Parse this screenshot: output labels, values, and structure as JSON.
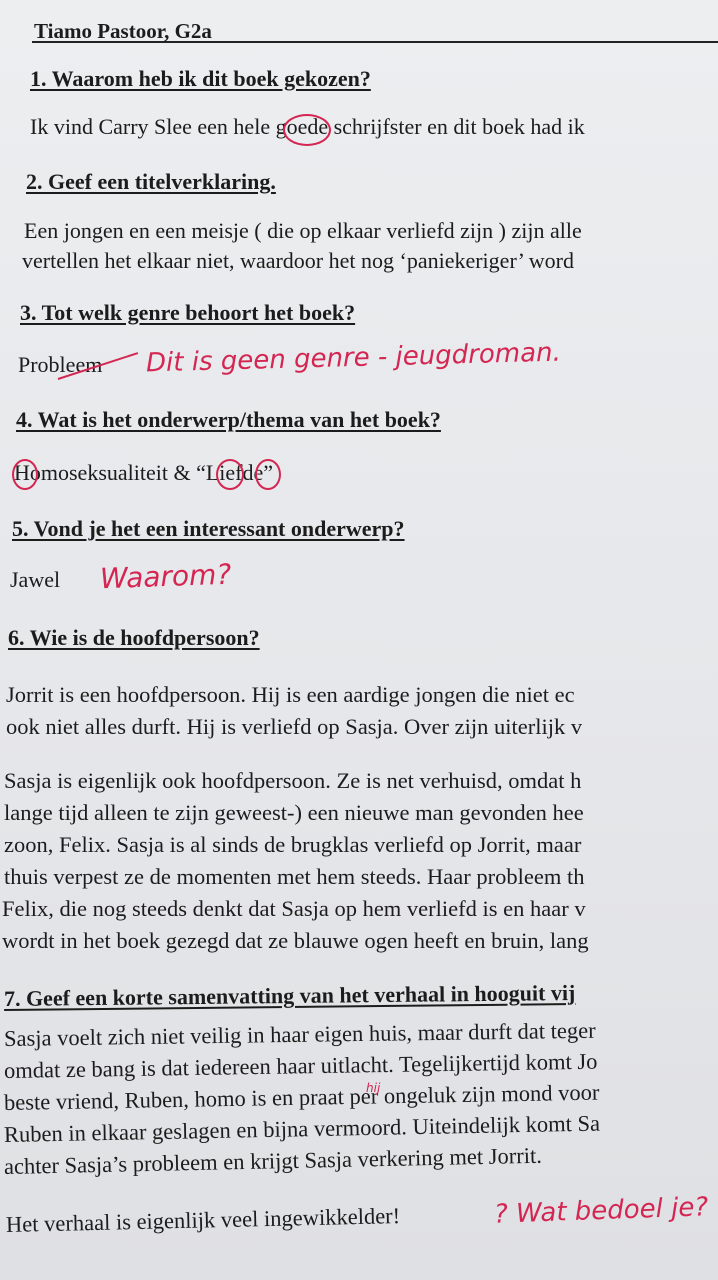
{
  "header": {
    "name": "Tiamo Pastoor, G2a"
  },
  "sections": [
    {
      "heading": "1. Waarom heb ik dit boek gekozen?",
      "lines": [
        "Ik vind Carry Slee een hele goede schrijfster en dit boek had ik"
      ]
    },
    {
      "heading": "2. Geef een titelverklaring.",
      "lines": [
        "Een jongen en een meisje ( die op elkaar verliefd zijn ) zijn alle",
        "vertellen het elkaar niet, waardoor het nog ‘paniekeriger’ word"
      ]
    },
    {
      "heading": "3. Tot welk genre behoort het boek?",
      "lines": [
        "Probleem"
      ]
    },
    {
      "heading": "4. Wat is het onderwerp/thema van het boek?",
      "lines": [
        "Homoseksualiteit & “Liefde”"
      ]
    },
    {
      "heading": "5. Vond je het een interessant onderwerp?",
      "lines": [
        "Jawel"
      ]
    },
    {
      "heading": "6. Wie is de hoofdpersoon?",
      "lines": [
        "Jorrit is een hoofdpersoon. Hij is een aardige jongen die niet ec",
        "ook niet alles durft. Hij is verliefd op Sasja. Over zijn uiterlijk v",
        "Sasja is eigenlijk ook hoofdpersoon. Ze is net verhuisd, omdat h",
        "lange tijd alleen te zijn geweest-) een nieuwe man gevonden hee",
        "zoon, Felix. Sasja is al sinds de brugklas verliefd op Jorrit, maar",
        "thuis verpest ze de momenten met hem steeds. Haar probleem th",
        "Felix, die nog steeds denkt dat Sasja op hem verliefd is en haar v",
        "wordt in het boek gezegd dat ze blauwe ogen heeft en bruin, lang"
      ]
    },
    {
      "heading": "7. Geef een korte samenvatting van het verhaal in hooguit vij",
      "lines": [
        "Sasja voelt zich niet veilig in haar eigen huis, maar durft dat teger",
        "omdat ze bang is dat iedereen haar uitlacht. Tegelijkertijd komt Jo",
        "beste vriend, Ruben, homo is en praat per ongeluk zijn mond voor",
        "Ruben in elkaar geslagen en bijna vermoord. Uiteindelijk komt Sa",
        "achter Sasja’s probleem en krijgt Sasja verkering met Jorrit.",
        "Het verhaal is eigenlijk veel ingewikkelder!"
      ]
    }
  ],
  "annotations": {
    "genre_comment": "Dit is geen genre - jeugdroman.",
    "why_comment": "Waarom?",
    "summary_comment": "? Wat bedoel je?",
    "insert_mark": "hij"
  },
  "colors": {
    "ink": "#1c1c1c",
    "red_pen": "#d42652",
    "paper": "#e9eaec"
  }
}
